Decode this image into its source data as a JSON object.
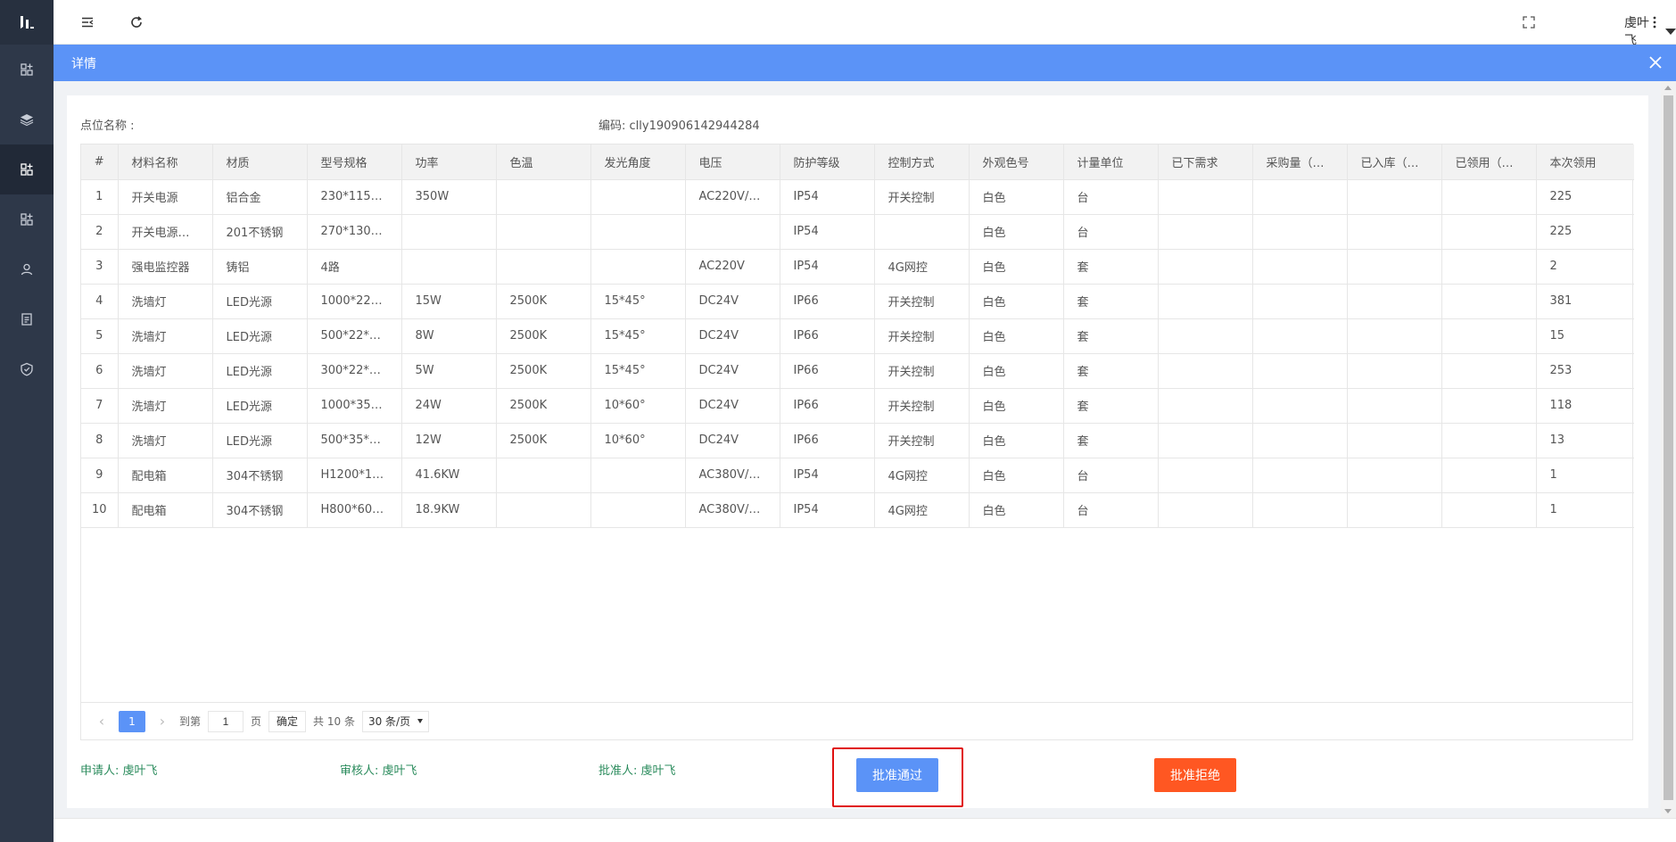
{
  "sidebar": {
    "logo": "ᴸᴵ",
    "items": [
      {
        "icon": "grid-plus-icon",
        "active": false
      },
      {
        "icon": "layers-icon",
        "active": false
      },
      {
        "icon": "grid-plus-icon",
        "active": true
      },
      {
        "icon": "grid-plus-icon",
        "active": false
      },
      {
        "icon": "user-icon",
        "active": false
      },
      {
        "icon": "clipboard-icon",
        "active": false
      },
      {
        "icon": "shield-check-icon",
        "active": false
      }
    ]
  },
  "topbar": {
    "username": "虔叶飞"
  },
  "panel": {
    "title": "详情"
  },
  "meta": {
    "location_label": "点位名称 :",
    "code_label": "编码: clly190906142944284"
  },
  "table": {
    "headers": [
      "#",
      "材料名称",
      "材质",
      "型号规格",
      "功率",
      "色温",
      "发光角度",
      "电压",
      "防护等级",
      "控制方式",
      "外观色号",
      "计量单位",
      "已下需求",
      "采购量（…",
      "已入库（…",
      "已领用（…",
      "本次领用"
    ],
    "rows": [
      [
        "1",
        "开关电源",
        "铝合金",
        "230*115*…",
        "350W",
        "",
        "",
        "AC220V/…",
        "IP54",
        "开关控制",
        "白色",
        "台",
        "",
        "",
        "",
        "",
        "225"
      ],
      [
        "2",
        "开关电源…",
        "201不锈钢",
        "270*130*…",
        "",
        "",
        "",
        "",
        "IP54",
        "",
        "白色",
        "台",
        "",
        "",
        "",
        "",
        "225"
      ],
      [
        "3",
        "强电监控器",
        "铸铝",
        "4路",
        "",
        "",
        "",
        "AC220V",
        "IP54",
        "4G网控",
        "白色",
        "套",
        "",
        "",
        "",
        "",
        "2"
      ],
      [
        "4",
        "洗墙灯",
        "LED光源",
        "1000*22*…",
        "15W",
        "2500K",
        "15*45°",
        "DC24V",
        "IP66",
        "开关控制",
        "白色",
        "套",
        "",
        "",
        "",
        "",
        "381"
      ],
      [
        "5",
        "洗墙灯",
        "LED光源",
        "500*22*H…",
        "8W",
        "2500K",
        "15*45°",
        "DC24V",
        "IP66",
        "开关控制",
        "白色",
        "套",
        "",
        "",
        "",
        "",
        "15"
      ],
      [
        "6",
        "洗墙灯",
        "LED光源",
        "300*22*H…",
        "5W",
        "2500K",
        "15*45°",
        "DC24V",
        "IP66",
        "开关控制",
        "白色",
        "套",
        "",
        "",
        "",
        "",
        "253"
      ],
      [
        "7",
        "洗墙灯",
        "LED光源",
        "1000*35*…",
        "24W",
        "2500K",
        "10*60°",
        "DC24V",
        "IP66",
        "开关控制",
        "白色",
        "套",
        "",
        "",
        "",
        "",
        "118"
      ],
      [
        "8",
        "洗墙灯",
        "LED光源",
        "500*35*H…",
        "12W",
        "2500K",
        "10*60°",
        "DC24V",
        "IP66",
        "开关控制",
        "白色",
        "套",
        "",
        "",
        "",
        "",
        "13"
      ],
      [
        "9",
        "配电箱",
        "304不锈钢",
        "H1200*1…",
        "41.6KW",
        "",
        "",
        "AC380V/…",
        "IP54",
        "4G网控",
        "白色",
        "台",
        "",
        "",
        "",
        "",
        "1"
      ],
      [
        "10",
        "配电箱",
        "304不锈钢",
        "H800*60…",
        "18.9KW",
        "",
        "",
        "AC380V/…",
        "IP54",
        "4G网控",
        "白色",
        "台",
        "",
        "",
        "",
        "",
        "1"
      ]
    ]
  },
  "pager": {
    "current": "1",
    "goto_label": "到第",
    "page_input": "1",
    "page_unit": "页",
    "confirm": "确定",
    "total": "共 10 条",
    "page_size": "30 条/页"
  },
  "footer": {
    "applicant": "申请人: 虔叶飞",
    "reviewer": "审核人: 虔叶飞",
    "approver": "批准人: 虔叶飞",
    "approve_button": "批准通过",
    "reject_button": "批准拒绝"
  },
  "colors": {
    "sidebar_bg": "#2e3849",
    "primary": "#5b93f7",
    "danger": "#ff5722",
    "person_text": "#2a8b5c",
    "highlight_border": "#e01010"
  }
}
